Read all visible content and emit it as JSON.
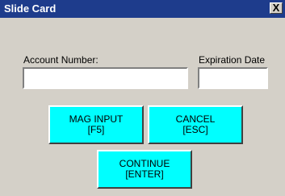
{
  "window": {
    "title": "Slide Card",
    "close_glyph": "X"
  },
  "form": {
    "account_number_label": "Account Number:",
    "account_number_value": "",
    "expiration_date_label": "Expiration Date",
    "expiration_date_value": ""
  },
  "buttons": {
    "mag_input": {
      "line1": "MAG INPUT",
      "line2": "[F5]"
    },
    "cancel": {
      "line1": "CANCEL",
      "line2": "[ESC]"
    },
    "continue": {
      "line1": "CONTINUE",
      "line2": "[ENTER]"
    }
  },
  "colors": {
    "titlebar": "#1e3c8c",
    "button_fill": "#00ffff",
    "window_background": "#d4d0c8"
  },
  "icons": {
    "close": "close-icon"
  }
}
